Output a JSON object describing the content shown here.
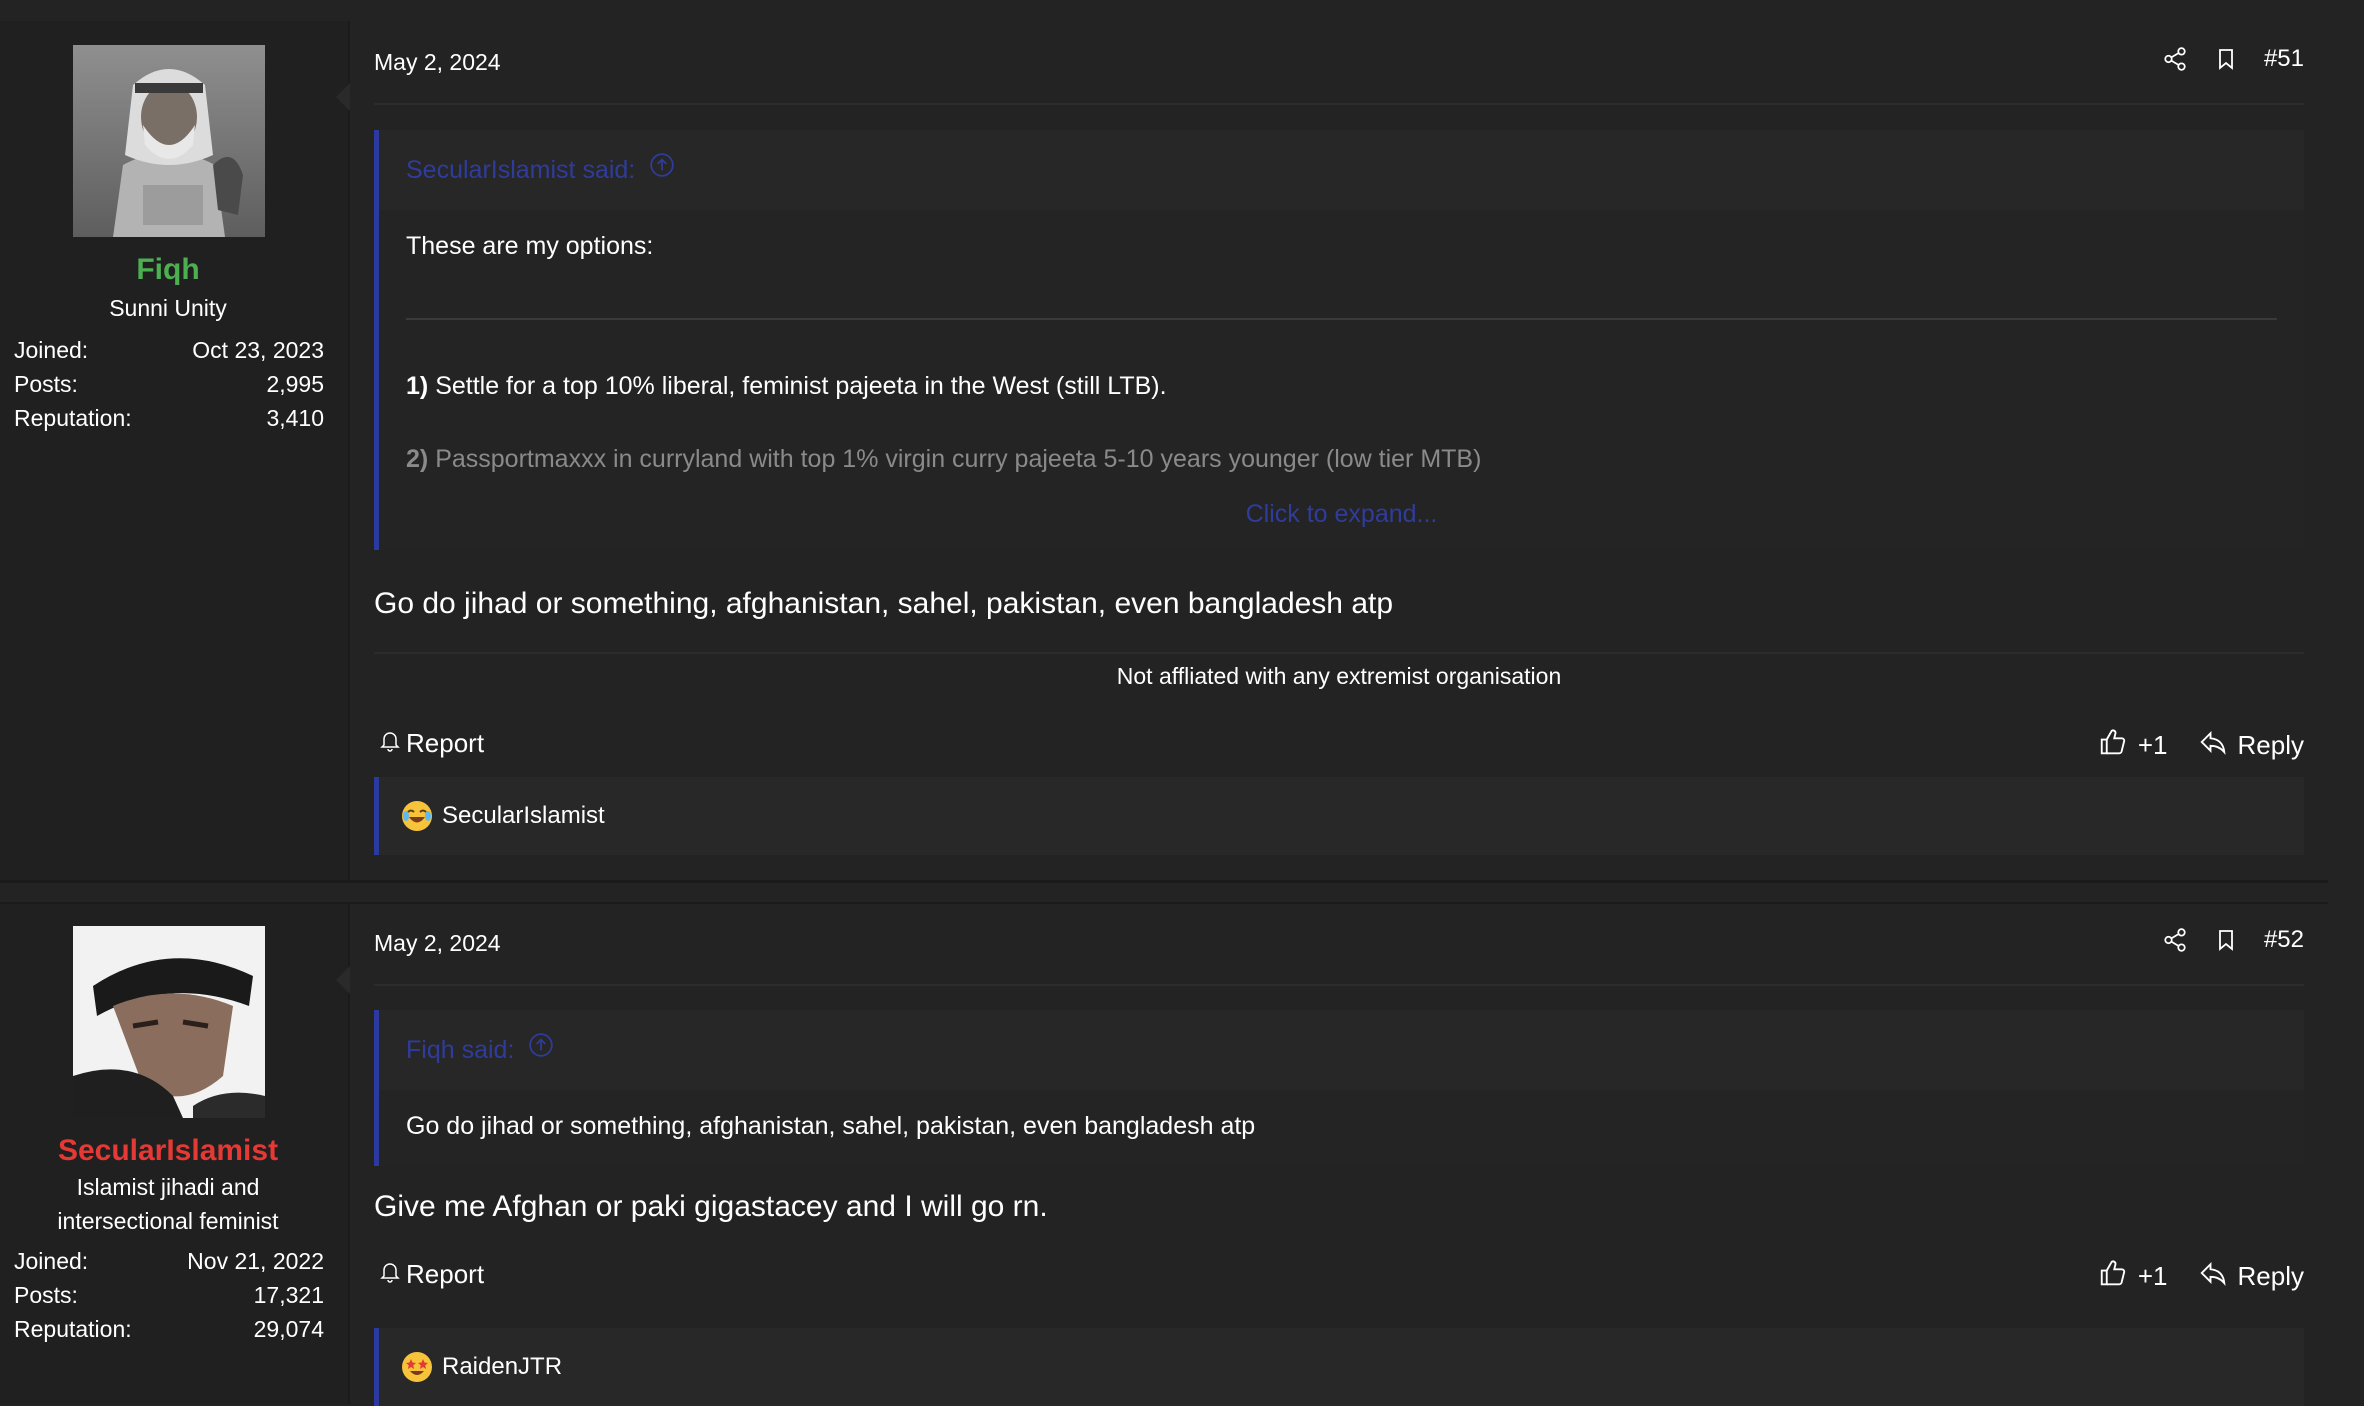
{
  "posts": [
    {
      "user": {
        "name": "Fiqh",
        "name_color": "#4caf50",
        "title": "Sunni Unity",
        "stats": [
          {
            "label": "Joined:",
            "value": "Oct 23, 2023"
          },
          {
            "label": "Posts:",
            "value": "2,995"
          },
          {
            "label": "Reputation:",
            "value": "3,410"
          }
        ]
      },
      "date": "May 2, 2024",
      "number": "#51",
      "quote": {
        "author": "SecularIslamist said:",
        "lines": [
          "These are my options:",
          "Settle for a top 10% liberal, feminist pajeeta in the West (still LTB).",
          "Passportmaxxx in curryland with top 1% virgin curry pajeeta 5-10 years younger (low tier MTB)"
        ],
        "numbers": [
          "1)",
          "2)"
        ],
        "expand": "Click to expand..."
      },
      "body": "Go do jihad or something, afghanistan, sahel, pakistan, even bangladesh atp",
      "signature": "Not affliated with any extremist organisation",
      "report": "Report",
      "like": "+1",
      "reply": "Reply",
      "reaction": {
        "emoji": "laughing-crying",
        "user": "SecularIslamist"
      }
    },
    {
      "user": {
        "name": "SecularIslamist",
        "name_color": "#e53935",
        "title_lines": [
          "Islamist jihadi and",
          "intersectional feminist"
        ],
        "stats": [
          {
            "label": "Joined:",
            "value": "Nov 21, 2022"
          },
          {
            "label": "Posts:",
            "value": "17,321"
          },
          {
            "label": "Reputation:",
            "value": "29,074"
          }
        ]
      },
      "date": "May 2, 2024",
      "number": "#52",
      "quote": {
        "author": "Fiqh said:",
        "lines": [
          "Go do jihad or something, afghanistan, sahel, pakistan, even bangladesh atp"
        ]
      },
      "body": "Give me Afghan or paki gigastacey and I will go rn.",
      "report": "Report",
      "like": "+1",
      "reply": "Reply",
      "reaction": {
        "emoji": "star-struck",
        "user": "RaidenJTR"
      }
    }
  ]
}
